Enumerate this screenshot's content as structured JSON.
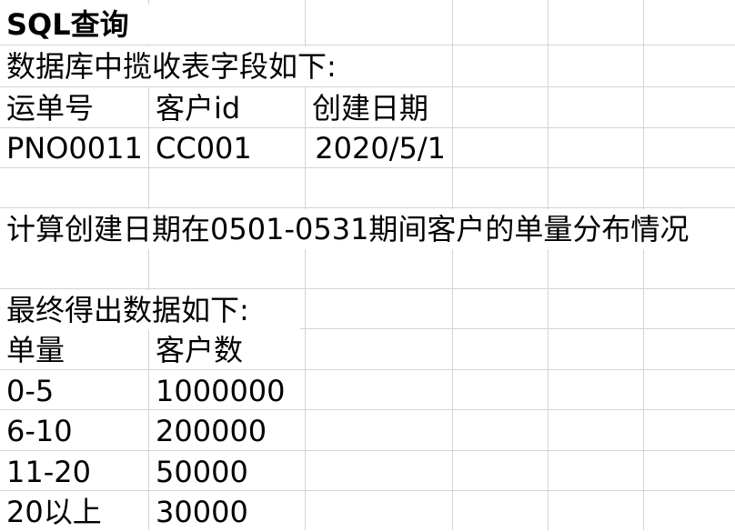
{
  "sheet": {
    "title": "SQL查询",
    "intro": "数据库中揽收表字段如下:",
    "fields_header": [
      "运单号",
      "客户id",
      "创建日期"
    ],
    "fields_row": [
      "PNO0011",
      "CC001",
      "2020/5/1"
    ],
    "task": "计算创建日期在0501-0531期间客户的单量分布情况",
    "result_intro": "最终得出数据如下:",
    "result_header": [
      "单量",
      "客户数"
    ],
    "result_rows": [
      [
        "0-5",
        "1000000"
      ],
      [
        "6-10",
        "200000"
      ],
      [
        "11-20",
        "50000"
      ],
      [
        "20以上",
        "30000"
      ]
    ]
  }
}
